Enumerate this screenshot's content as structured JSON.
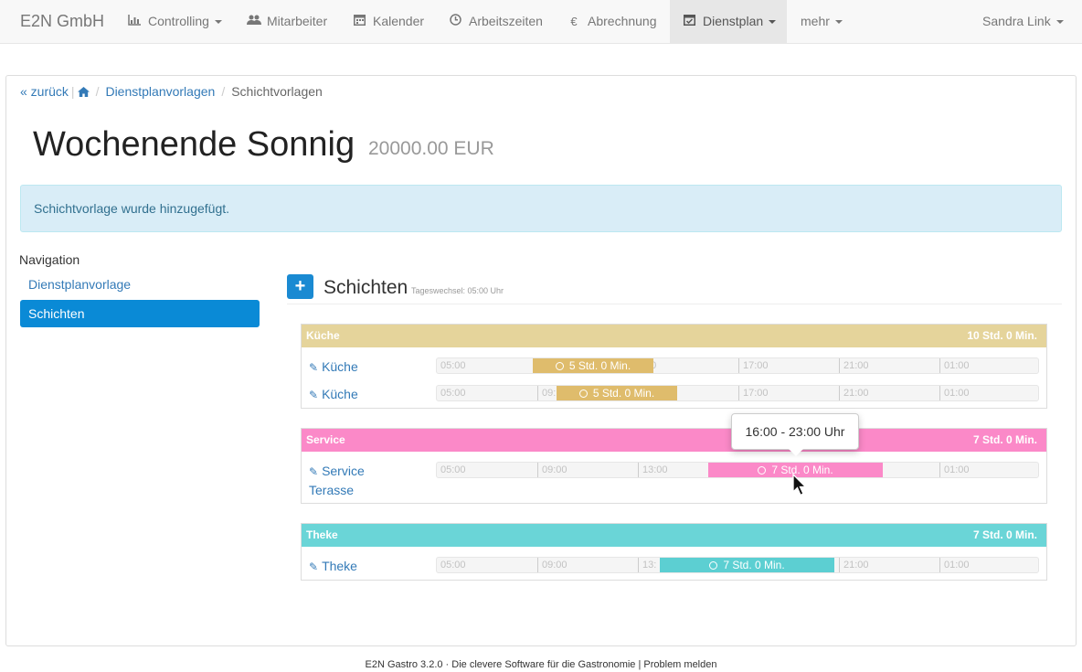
{
  "navbar": {
    "brand": "E2N GmbH",
    "items": [
      {
        "label": "Controlling",
        "icon": "bar-chart-icon"
      },
      {
        "label": "Mitarbeiter",
        "icon": "users-icon"
      },
      {
        "label": "Kalender",
        "icon": "calendar-icon"
      },
      {
        "label": "Arbeitszeiten",
        "icon": "clock-icon"
      },
      {
        "label": "Abrechnung",
        "icon": "euro-icon"
      },
      {
        "label": "Dienstplan",
        "icon": "calendar-check-icon",
        "active": true
      },
      {
        "label": "mehr"
      }
    ],
    "user": "Sandra Link"
  },
  "breadcrumb": {
    "back": "« zurück",
    "home_icon": "home-icon",
    "parent": "Dienstplanvorlagen",
    "current": "Schichtvorlagen"
  },
  "page": {
    "title": "Wochenende Sonnig",
    "amount": "20000.00 EUR"
  },
  "alert": "Schichtvorlage wurde hinzugefügt.",
  "sidebar": {
    "heading": "Navigation",
    "items": [
      "Dienstplanvorlage",
      "Schichten"
    ]
  },
  "section": {
    "add_icon": "+",
    "title": "Schichten",
    "subtitle": "Tageswechsel: 05:00 Uhr"
  },
  "groups": [
    {
      "name": "Küche",
      "total": "10 Std. 0 Min.",
      "color": "#e5d49b",
      "bar_color": "#dfbc6c",
      "rows": [
        {
          "label": "Küche",
          "bar": "5 Std. 0 Min.",
          "ticks": [
            "05:00",
            "",
            ":00",
            "17:00",
            "21:00",
            "01:00"
          ]
        },
        {
          "label": "Küche",
          "bar": "5 Std. 0 Min.",
          "ticks": [
            "05:00",
            "09:",
            "",
            "17:00",
            "21:00",
            "01:00"
          ]
        }
      ]
    },
    {
      "name": "Service",
      "total": "7 Std. 0 Min.",
      "color": "#fb89c8",
      "bar_color": "#fb89c8",
      "rows": [
        {
          "label": "Service",
          "label2": "Terasse",
          "bar": "7 Std. 0 Min.",
          "ticks": [
            "05:00",
            "09:00",
            "13:00",
            "",
            "",
            "01:00"
          ]
        }
      ]
    },
    {
      "name": "Theke",
      "total": "7 Std. 0 Min.",
      "color": "#6ad5d7",
      "bar_color": "#5ccfd2",
      "rows": [
        {
          "label": "Theke",
          "bar": "7 Std. 0 Min.",
          "ticks": [
            "05:00",
            "09:00",
            "13:",
            "",
            "21:00",
            "01:00"
          ]
        }
      ]
    }
  ],
  "tooltip": "16:00 - 23:00 Uhr",
  "footer": "E2N Gastro 3.2.0 · Die clevere Software für die Gastronomie | Problem melden"
}
